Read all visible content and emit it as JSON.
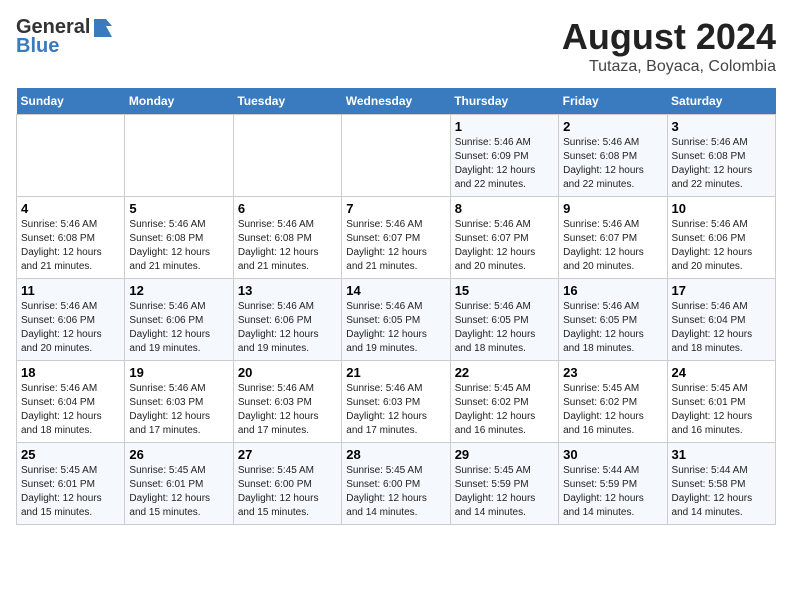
{
  "header": {
    "logo_general": "General",
    "logo_blue": "Blue",
    "title": "August 2024",
    "subtitle": "Tutaza, Boyaca, Colombia"
  },
  "weekdays": [
    "Sunday",
    "Monday",
    "Tuesday",
    "Wednesday",
    "Thursday",
    "Friday",
    "Saturday"
  ],
  "weeks": [
    [
      {
        "day": "",
        "info": ""
      },
      {
        "day": "",
        "info": ""
      },
      {
        "day": "",
        "info": ""
      },
      {
        "day": "",
        "info": ""
      },
      {
        "day": "1",
        "info": "Sunrise: 5:46 AM\nSunset: 6:09 PM\nDaylight: 12 hours\nand 22 minutes."
      },
      {
        "day": "2",
        "info": "Sunrise: 5:46 AM\nSunset: 6:08 PM\nDaylight: 12 hours\nand 22 minutes."
      },
      {
        "day": "3",
        "info": "Sunrise: 5:46 AM\nSunset: 6:08 PM\nDaylight: 12 hours\nand 22 minutes."
      }
    ],
    [
      {
        "day": "4",
        "info": "Sunrise: 5:46 AM\nSunset: 6:08 PM\nDaylight: 12 hours\nand 21 minutes."
      },
      {
        "day": "5",
        "info": "Sunrise: 5:46 AM\nSunset: 6:08 PM\nDaylight: 12 hours\nand 21 minutes."
      },
      {
        "day": "6",
        "info": "Sunrise: 5:46 AM\nSunset: 6:08 PM\nDaylight: 12 hours\nand 21 minutes."
      },
      {
        "day": "7",
        "info": "Sunrise: 5:46 AM\nSunset: 6:07 PM\nDaylight: 12 hours\nand 21 minutes."
      },
      {
        "day": "8",
        "info": "Sunrise: 5:46 AM\nSunset: 6:07 PM\nDaylight: 12 hours\nand 20 minutes."
      },
      {
        "day": "9",
        "info": "Sunrise: 5:46 AM\nSunset: 6:07 PM\nDaylight: 12 hours\nand 20 minutes."
      },
      {
        "day": "10",
        "info": "Sunrise: 5:46 AM\nSunset: 6:06 PM\nDaylight: 12 hours\nand 20 minutes."
      }
    ],
    [
      {
        "day": "11",
        "info": "Sunrise: 5:46 AM\nSunset: 6:06 PM\nDaylight: 12 hours\nand 20 minutes."
      },
      {
        "day": "12",
        "info": "Sunrise: 5:46 AM\nSunset: 6:06 PM\nDaylight: 12 hours\nand 19 minutes."
      },
      {
        "day": "13",
        "info": "Sunrise: 5:46 AM\nSunset: 6:06 PM\nDaylight: 12 hours\nand 19 minutes."
      },
      {
        "day": "14",
        "info": "Sunrise: 5:46 AM\nSunset: 6:05 PM\nDaylight: 12 hours\nand 19 minutes."
      },
      {
        "day": "15",
        "info": "Sunrise: 5:46 AM\nSunset: 6:05 PM\nDaylight: 12 hours\nand 18 minutes."
      },
      {
        "day": "16",
        "info": "Sunrise: 5:46 AM\nSunset: 6:05 PM\nDaylight: 12 hours\nand 18 minutes."
      },
      {
        "day": "17",
        "info": "Sunrise: 5:46 AM\nSunset: 6:04 PM\nDaylight: 12 hours\nand 18 minutes."
      }
    ],
    [
      {
        "day": "18",
        "info": "Sunrise: 5:46 AM\nSunset: 6:04 PM\nDaylight: 12 hours\nand 18 minutes."
      },
      {
        "day": "19",
        "info": "Sunrise: 5:46 AM\nSunset: 6:03 PM\nDaylight: 12 hours\nand 17 minutes."
      },
      {
        "day": "20",
        "info": "Sunrise: 5:46 AM\nSunset: 6:03 PM\nDaylight: 12 hours\nand 17 minutes."
      },
      {
        "day": "21",
        "info": "Sunrise: 5:46 AM\nSunset: 6:03 PM\nDaylight: 12 hours\nand 17 minutes."
      },
      {
        "day": "22",
        "info": "Sunrise: 5:45 AM\nSunset: 6:02 PM\nDaylight: 12 hours\nand 16 minutes."
      },
      {
        "day": "23",
        "info": "Sunrise: 5:45 AM\nSunset: 6:02 PM\nDaylight: 12 hours\nand 16 minutes."
      },
      {
        "day": "24",
        "info": "Sunrise: 5:45 AM\nSunset: 6:01 PM\nDaylight: 12 hours\nand 16 minutes."
      }
    ],
    [
      {
        "day": "25",
        "info": "Sunrise: 5:45 AM\nSunset: 6:01 PM\nDaylight: 12 hours\nand 15 minutes."
      },
      {
        "day": "26",
        "info": "Sunrise: 5:45 AM\nSunset: 6:01 PM\nDaylight: 12 hours\nand 15 minutes."
      },
      {
        "day": "27",
        "info": "Sunrise: 5:45 AM\nSunset: 6:00 PM\nDaylight: 12 hours\nand 15 minutes."
      },
      {
        "day": "28",
        "info": "Sunrise: 5:45 AM\nSunset: 6:00 PM\nDaylight: 12 hours\nand 14 minutes."
      },
      {
        "day": "29",
        "info": "Sunrise: 5:45 AM\nSunset: 5:59 PM\nDaylight: 12 hours\nand 14 minutes."
      },
      {
        "day": "30",
        "info": "Sunrise: 5:44 AM\nSunset: 5:59 PM\nDaylight: 12 hours\nand 14 minutes."
      },
      {
        "day": "31",
        "info": "Sunrise: 5:44 AM\nSunset: 5:58 PM\nDaylight: 12 hours\nand 14 minutes."
      }
    ]
  ]
}
